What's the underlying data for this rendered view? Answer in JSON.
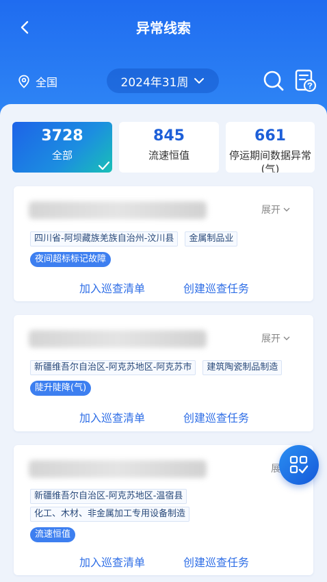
{
  "header": {
    "title": "异常线索",
    "location": "全国",
    "week": "2024年31周"
  },
  "stats": [
    {
      "value": "3728",
      "label": "全部"
    },
    {
      "value": "845",
      "label": "流速恒值"
    },
    {
      "value": "661",
      "label": "停运期间数据异常(气)"
    }
  ],
  "cards": [
    {
      "expand": "展开",
      "tags": [
        "四川省-阿坝藏族羌族自治州-汶川县",
        "金属制品业"
      ],
      "status": "夜间超标标记故障",
      "actions": [
        "加入巡查清单",
        "创建巡查任务"
      ]
    },
    {
      "expand": "展开",
      "tags": [
        "新疆维吾尔自治区-阿克苏地区-阿克苏市",
        "建筑陶瓷制品制造"
      ],
      "status": "陡升陡降(气)",
      "actions": [
        "加入巡查清单",
        "创建巡查任务"
      ]
    },
    {
      "expand": "展开",
      "tags": [
        "新疆维吾尔自治区-阿克苏地区-温宿县",
        "化工、木材、非金属加工专用设备制造"
      ],
      "status": "流速恒值",
      "actions": [
        "加入巡查清单",
        "创建巡查任务"
      ]
    }
  ],
  "colors": {
    "primary": "#1f6cf0",
    "accent": "#2d6de6",
    "background": "#eef3fb"
  }
}
